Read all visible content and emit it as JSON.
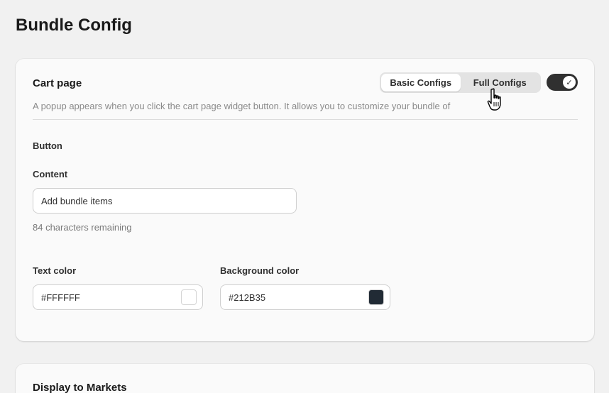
{
  "page": {
    "title": "Bundle Config"
  },
  "cart": {
    "title": "Cart page",
    "description": "A popup appears when you click the cart page widget button. It allows you to customize your bundle of",
    "tabs": [
      {
        "label": "Basic Configs",
        "active": true
      },
      {
        "label": "Full Configs",
        "active": false
      }
    ],
    "toggle": {
      "enabled": true
    }
  },
  "button_section": {
    "heading": "Button",
    "content_label": "Content",
    "content_value": "Add bundle items",
    "helper": "84 characters remaining",
    "text_color_label": "Text color",
    "text_color_value": "#FFFFFF",
    "bg_color_label": "Background color",
    "bg_color_value": "#212B35"
  },
  "markets": {
    "title": "Display to Markets"
  },
  "colors": {
    "text_swatch": "#FFFFFF",
    "bg_swatch": "#212B35",
    "toggle_on": "#303030"
  }
}
